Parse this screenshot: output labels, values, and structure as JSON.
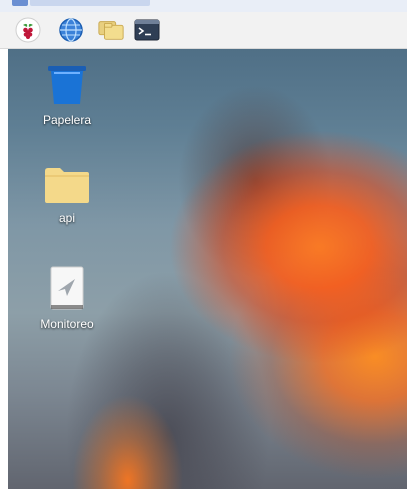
{
  "taskbar": {
    "launchers": [
      {
        "name": "raspberry-menu",
        "icon": "raspberry-icon"
      },
      {
        "name": "web-browser",
        "icon": "globe-icon"
      },
      {
        "name": "file-manager",
        "icon": "folders-icon"
      },
      {
        "name": "terminal",
        "icon": "terminal-icon"
      }
    ]
  },
  "desktop": {
    "icons": [
      {
        "label": "Papelera",
        "icon": "trash-icon"
      },
      {
        "label": "api",
        "icon": "folder-icon"
      },
      {
        "label": "Monitoreo",
        "icon": "document-icon"
      }
    ]
  },
  "colors": {
    "taskbar_bg": "#f2f2f2",
    "trash_blue": "#1a6fd1",
    "folder_yellow": "#f3d67d"
  }
}
